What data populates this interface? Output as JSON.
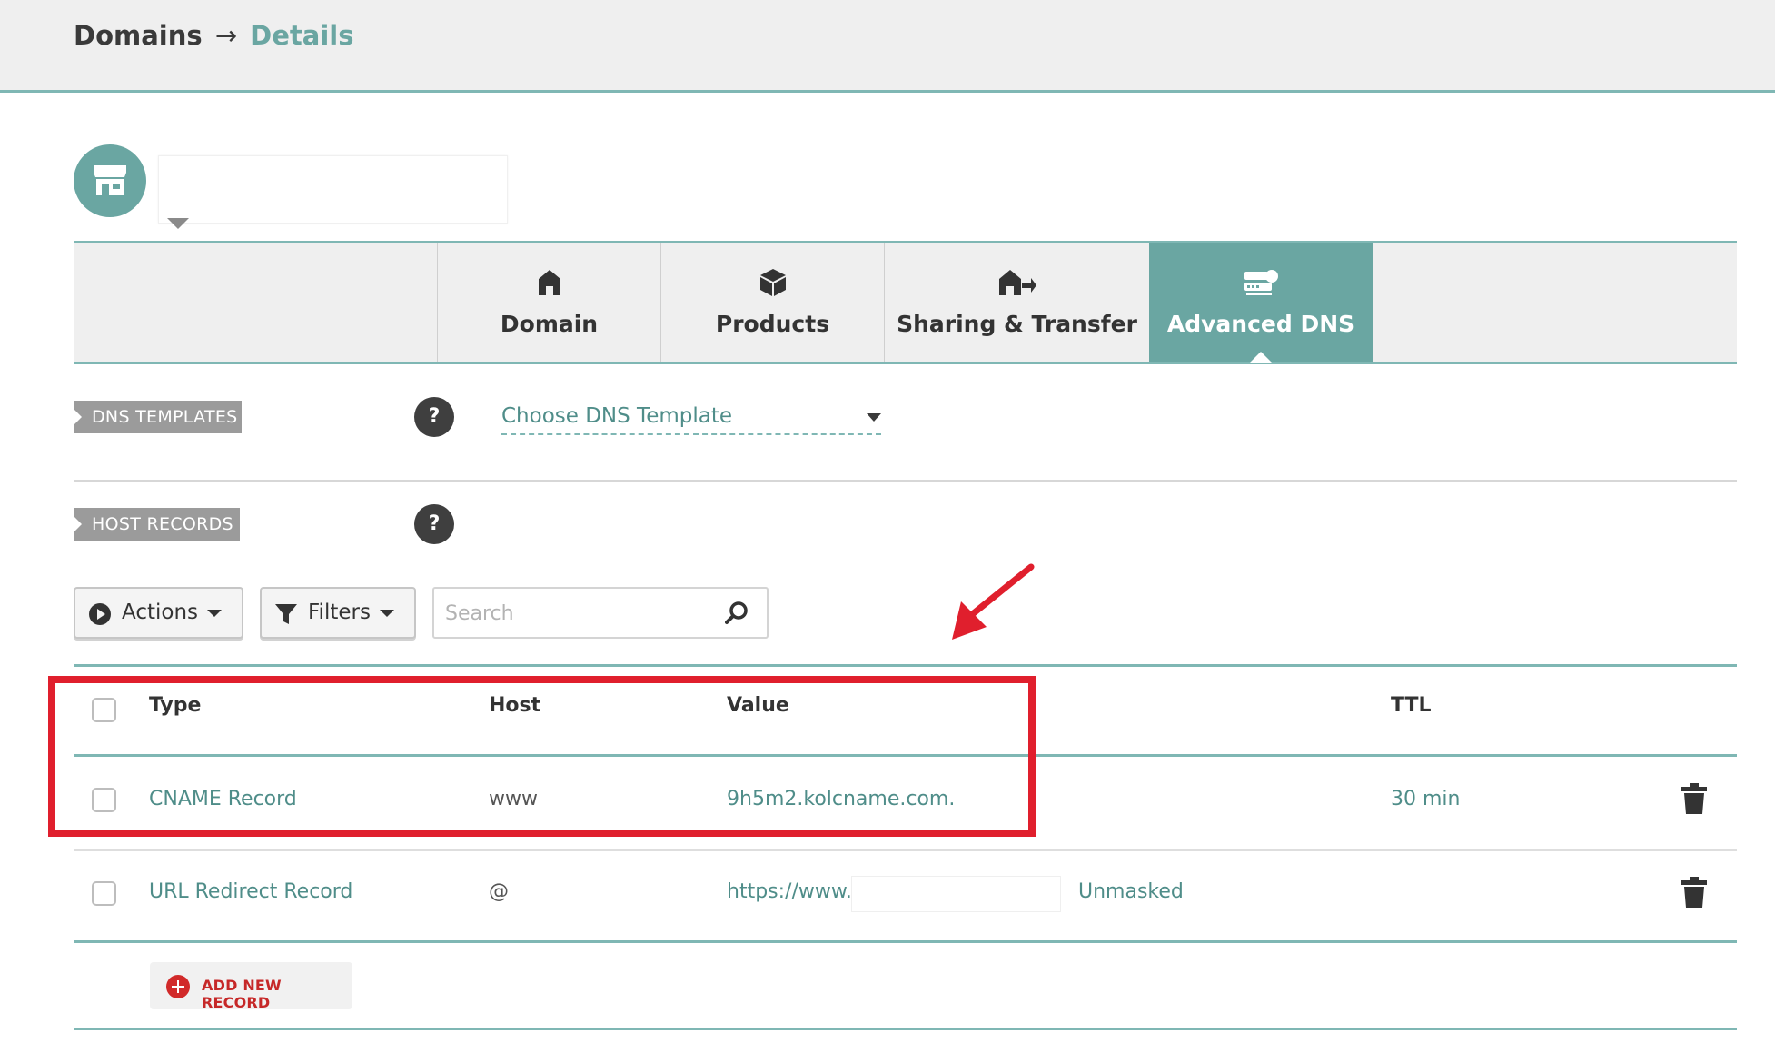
{
  "breadcrumb": {
    "root": "Domains",
    "separator": "→",
    "current": "Details"
  },
  "tabs": [
    {
      "label": "Domain",
      "icon": "house-icon"
    },
    {
      "label": "Products",
      "icon": "box-icon"
    },
    {
      "label": "Sharing & Transfer",
      "icon": "house-transfer-icon"
    },
    {
      "label": "Advanced DNS",
      "icon": "dns-server-icon",
      "active": true
    }
  ],
  "dns_templates": {
    "label": "DNS TEMPLATES",
    "help": "?",
    "select_value": "Choose DNS Template"
  },
  "host_records": {
    "label": "HOST RECORDS",
    "help": "?"
  },
  "toolbar": {
    "actions_label": "Actions",
    "filters_label": "Filters",
    "search_placeholder": "Search"
  },
  "table": {
    "columns": {
      "type": "Type",
      "host": "Host",
      "value": "Value",
      "ttl": "TTL"
    },
    "rows": [
      {
        "type": "CNAME Record",
        "host": "www",
        "value": "9h5m2.kolcname.com.",
        "ttl": "30 min"
      },
      {
        "type": "URL Redirect Record",
        "host": "@",
        "value": "https://www.",
        "extra": "Unmasked",
        "ttl": ""
      }
    ]
  },
  "add_record_label": "ADD NEW RECORD",
  "colors": {
    "accent": "#6aa6a2",
    "highlight": "#e01f2d",
    "danger": "#c62828"
  }
}
